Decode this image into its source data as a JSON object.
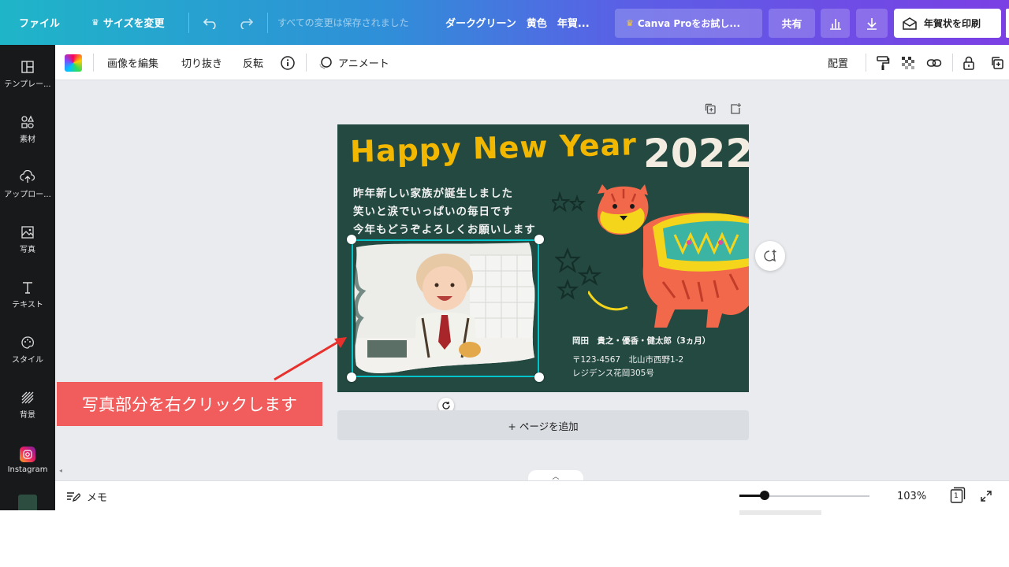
{
  "topbar": {
    "file": "ファイル",
    "resize": "サイズを変更",
    "saved_status": "すべての変更は保存されました",
    "doc_title": "ダークグリーン　黄色　年賀...",
    "canva_pro": "Canva Proをお試し...",
    "share": "共有",
    "print": "年賀状を印刷"
  },
  "sidebar": {
    "items": [
      {
        "label": "テンプレー...",
        "icon": "template-icon"
      },
      {
        "label": "素材",
        "icon": "elements-icon"
      },
      {
        "label": "アップロー...",
        "icon": "upload-icon"
      },
      {
        "label": "写真",
        "icon": "photo-icon"
      },
      {
        "label": "テキスト",
        "icon": "text-icon"
      },
      {
        "label": "スタイル",
        "icon": "palette-icon"
      },
      {
        "label": "背景",
        "icon": "background-icon"
      },
      {
        "label": "Instagram",
        "icon": "instagram-icon"
      }
    ]
  },
  "toolbar": {
    "edit_image": "画像を編集",
    "crop": "切り抜き",
    "flip": "反転",
    "animate": "アニメート",
    "position": "配置"
  },
  "design": {
    "title": "Happy New Year",
    "year": "2022",
    "message_lines": [
      "昨年新しい家族が誕生しました",
      "笑いと涙でいっぱいの毎日です",
      "今年もどうぞよろしくお願いします"
    ],
    "sender": "岡田　貴之・優香・健太郎（3ヵ月）",
    "address_line1": "〒123-4567　北山市西野1-2",
    "address_line2": "レジデンス花岡305号",
    "colors": {
      "background": "#234941",
      "title": "#f2b800",
      "year": "#f3ece0",
      "tiger": "#f2684a"
    }
  },
  "canvas": {
    "add_page": "+ ページを追加"
  },
  "annotation": {
    "text": "写真部分を右クリックします",
    "color": "#f15c5c"
  },
  "bottombar": {
    "notes": "メモ",
    "zoom": "103%",
    "page_number": "1"
  }
}
